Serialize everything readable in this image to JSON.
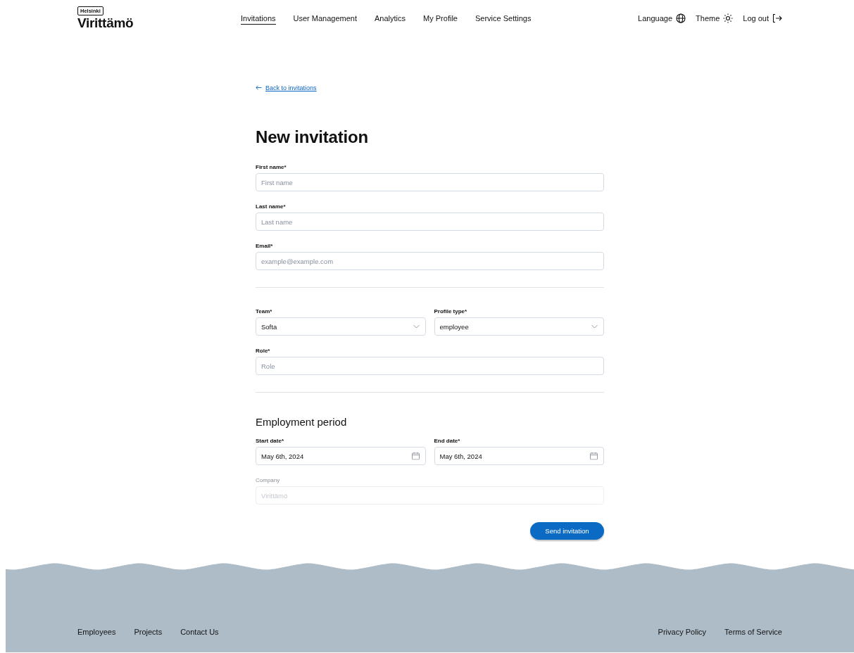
{
  "header": {
    "logo_badge": "Helsinki",
    "logo_text": "Virittämö",
    "nav": [
      {
        "label": "Invitations",
        "selected": true
      },
      {
        "label": "User Management",
        "selected": false
      },
      {
        "label": "Analytics",
        "selected": false
      },
      {
        "label": "My Profile",
        "selected": false
      },
      {
        "label": "Service Settings",
        "selected": false
      }
    ],
    "actions": [
      {
        "label": "Language",
        "kind": "globe"
      },
      {
        "label": "Theme",
        "kind": "sun"
      },
      {
        "label": "Log out",
        "kind": "logout"
      }
    ]
  },
  "back_link": "Back to invitations",
  "title": "New invitation",
  "sections": [
    {
      "rows": [
        [
          {
            "label": "First name*",
            "placeholder": "First name",
            "kind": "text",
            "disabled": false
          }
        ],
        [
          {
            "label": "Last name*",
            "placeholder": "Last name",
            "kind": "text",
            "disabled": false
          }
        ],
        [
          {
            "label": "Email*",
            "placeholder": "example@example.com",
            "kind": "text",
            "disabled": false
          }
        ]
      ]
    },
    {
      "rows": [
        [
          {
            "label": "Team*",
            "value": "Softa",
            "kind": "select",
            "disabled": false
          },
          {
            "label": "Profile type*",
            "value": "employee",
            "kind": "select",
            "disabled": false
          }
        ],
        [
          {
            "label": "Role*",
            "placeholder": "Role",
            "kind": "text",
            "disabled": false
          }
        ]
      ]
    },
    {
      "title": "Employment period",
      "rows": [
        [
          {
            "label": "Start date*",
            "value": "May 6th, 2024",
            "kind": "date",
            "disabled": false
          },
          {
            "label": "End date*",
            "value": "May 6th, 2024",
            "kind": "date",
            "disabled": false
          }
        ],
        [
          {
            "label": "Company",
            "placeholder": "Virittämö",
            "kind": "text",
            "disabled": true
          }
        ]
      ]
    }
  ],
  "submit": "Send invitation",
  "footer": {
    "left_links": [
      "Employees",
      "Projects",
      "Contact Us"
    ],
    "right_links": [
      "Privacy Policy",
      "Terms of Service"
    ]
  }
}
